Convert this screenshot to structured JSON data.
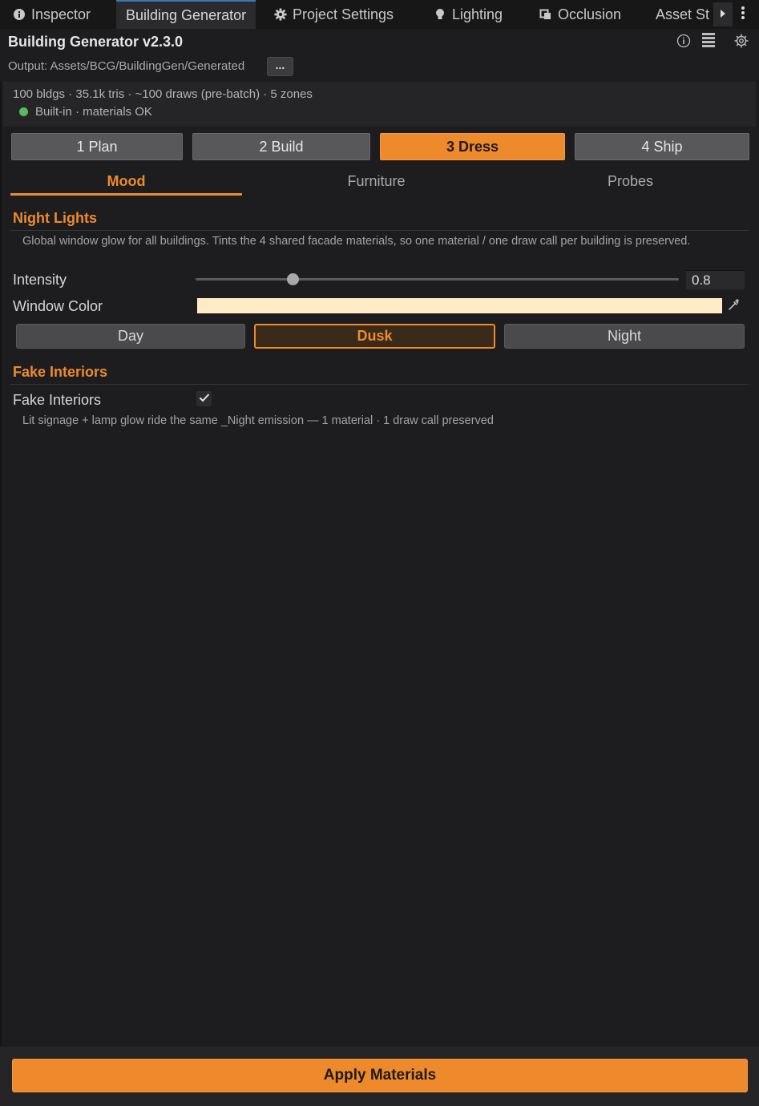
{
  "tabs": [
    {
      "label": "Inspector",
      "icon": "info-icon",
      "active": false
    },
    {
      "label": "Building Generator",
      "icon": "",
      "active": true
    },
    {
      "label": "Project Settings",
      "icon": "gear-icon",
      "active": false
    },
    {
      "label": "Lighting",
      "icon": "lightbulb-icon",
      "active": false
    },
    {
      "label": "Occlusion",
      "icon": "occlusion-icon",
      "active": false
    },
    {
      "label": "Asset St",
      "icon": "",
      "active": false
    }
  ],
  "header": {
    "title": "Building Generator v2.3.0",
    "output_label": "Output: Assets/BCG/BuildingGen/Generated",
    "browse_label": "..."
  },
  "stats": {
    "summary": "100 bldgs · 35.1k tris · ~100 draws (pre-batch) · 5 zones",
    "status": "Built-in · materials OK",
    "status_color": "#58b85f"
  },
  "steps": [
    {
      "label": "1 Plan",
      "active": false
    },
    {
      "label": "2 Build",
      "active": false
    },
    {
      "label": "3 Dress",
      "active": true
    },
    {
      "label": "4 Ship",
      "active": false
    }
  ],
  "subtabs": [
    {
      "label": "Mood",
      "active": true
    },
    {
      "label": "Furniture",
      "active": false
    },
    {
      "label": "Probes",
      "active": false
    }
  ],
  "night_lights": {
    "title": "Night Lights",
    "help": "Global window glow for all buildings. Tints the 4 shared facade materials, so one material / one draw call per building is preserved.",
    "intensity_label": "Intensity",
    "intensity_value": "0.8",
    "intensity_fraction": 0.2,
    "window_color_label": "Window Color",
    "window_color": "#ffebc6",
    "presets": [
      {
        "label": "Day",
        "active": false
      },
      {
        "label": "Dusk",
        "active": true
      },
      {
        "label": "Night",
        "active": false
      }
    ]
  },
  "fake_interiors": {
    "title": "Fake Interiors",
    "toggle_label": "Fake Interiors",
    "checked": true,
    "help": "Lit signage + lamp glow ride the same _Night emission — 1 material · 1 draw call preserved"
  },
  "footer": {
    "apply_label": "Apply Materials"
  },
  "colors": {
    "accent": "#ef8a2c",
    "background": "#1d1d1f"
  }
}
